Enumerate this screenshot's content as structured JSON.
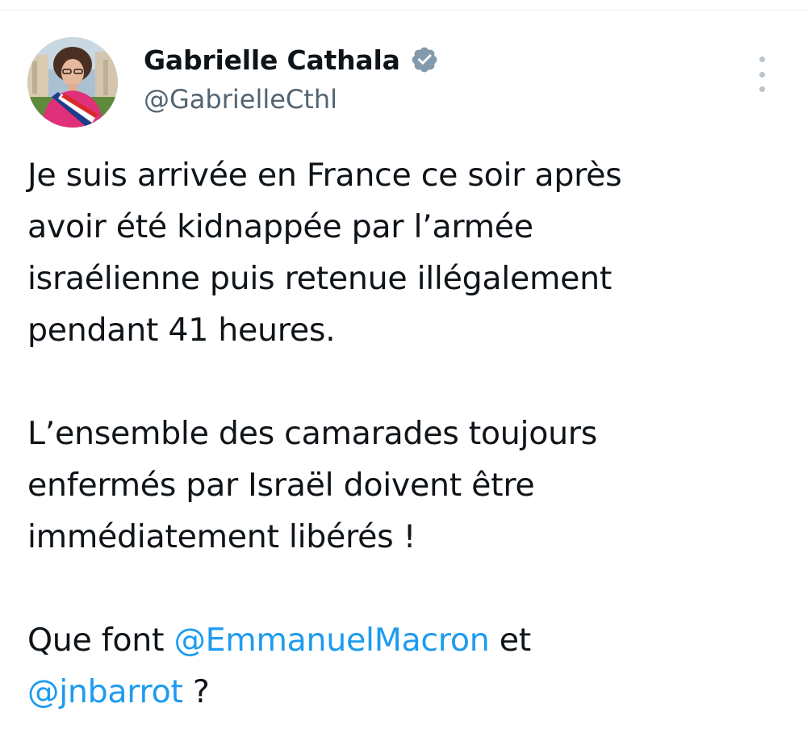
{
  "author": {
    "display_name": "Gabrielle Cathala",
    "handle": "@GabrielleCthl",
    "verified": true
  },
  "tweet": {
    "paragraph1_lines": [
      "Je suis arrivée en France ce soir après",
      "avoir été kidnappée par l’armée",
      "israélienne puis retenue illégalement",
      "pendant 41 heures."
    ],
    "paragraph2_lines": [
      "L’ensemble des camarades toujours",
      "enfermés par Israël doivent être",
      "immédiatement libérés !"
    ],
    "paragraph3": {
      "prefix": "Que font ",
      "mention1": "@EmmanuelMacron",
      "middle": " et",
      "mention2": "@jnbarrot",
      "suffix": " ?"
    }
  },
  "icons": {
    "verified": "verified-badge-icon",
    "more": "more-options-icon"
  },
  "colors": {
    "text": "#0f1419",
    "secondary": "#536471",
    "link": "#1d9bf0",
    "verified_badge": "#829aab"
  }
}
